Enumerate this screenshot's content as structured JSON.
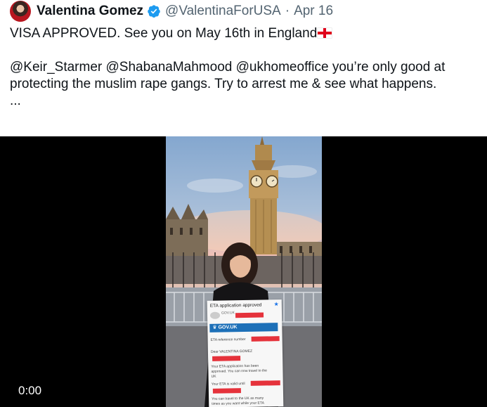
{
  "tweet": {
    "author_name": "Valentina Gomez",
    "handle": "@ValentinaForUSA",
    "separator": "·",
    "date": "Apr 16",
    "line1": "VISA APPROVED. See you on May 16th in England",
    "line2": "@Keir_Starmer @ShabanaMahmood @ukhomeoffice you’re only good at",
    "line3": "protecting the muslim rape gangs. Try to arrest me & see what happens.",
    "ellipsis": "..."
  },
  "video": {
    "timestamp": "0:00"
  },
  "document": {
    "subject": "ETA application approved",
    "sender": "GOV.UK",
    "govuk_label": "GOV.UK",
    "reference_label": "ETA reference number",
    "greeting": "Dear VALENTINA GOMEZ",
    "approved_text_1": "Your ETA application has been",
    "approved_text_2": "approved. You can now travel to the",
    "approved_text_3": "UK",
    "valid_label": "Your ETA is valid until",
    "travel_text_1": "You can travel to the UK as many",
    "travel_text_2": "times as you want while your ETA"
  },
  "colors": {
    "verified_badge": "#1d9bf0",
    "handle_gray": "#536471",
    "govuk_blue": "#1d70b8",
    "redaction_red": "#e5323b"
  }
}
